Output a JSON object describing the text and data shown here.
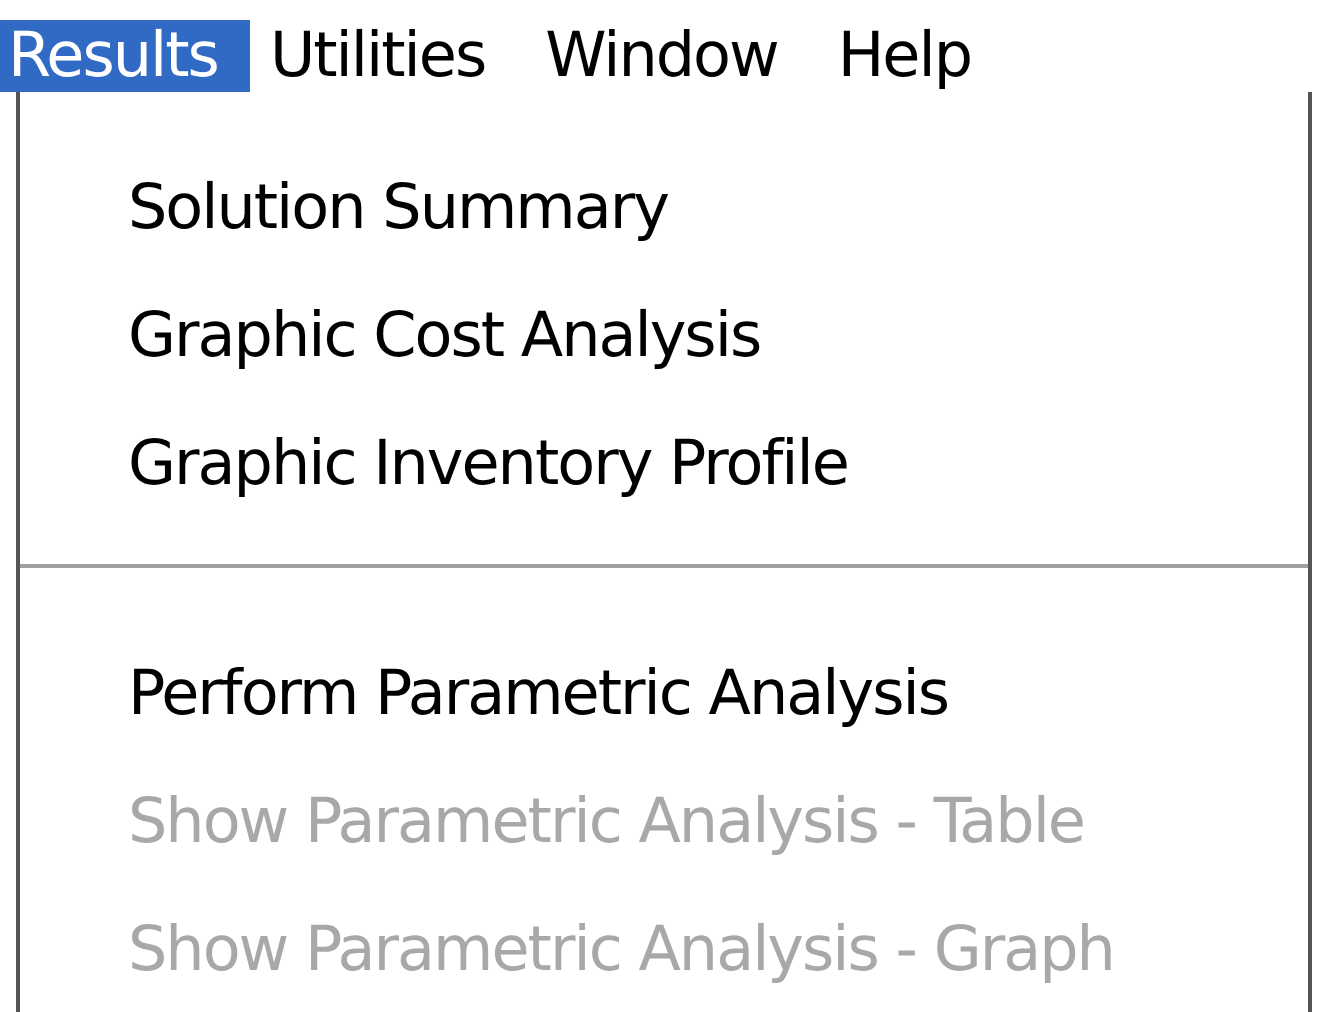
{
  "menu_bar": [
    {
      "label": "Results",
      "selected": true
    },
    {
      "label": "Utilities",
      "selected": false
    },
    {
      "label": "Window",
      "selected": false
    },
    {
      "label": "Help",
      "selected": false
    }
  ],
  "menu": [
    {
      "kind": "item",
      "label": "Solution Summary",
      "disabled": false
    },
    {
      "kind": "item",
      "label": "Graphic Cost Analysis",
      "disabled": false
    },
    {
      "kind": "item",
      "label": "Graphic Inventory Profile",
      "disabled": false
    },
    {
      "kind": "separator"
    },
    {
      "kind": "item",
      "label": "Perform Parametric Analysis",
      "disabled": false
    },
    {
      "kind": "item",
      "label": "Show Parametric Analysis - Table",
      "disabled": true
    },
    {
      "kind": "item",
      "label": "Show Parametric Analysis - Graph",
      "disabled": true
    }
  ]
}
